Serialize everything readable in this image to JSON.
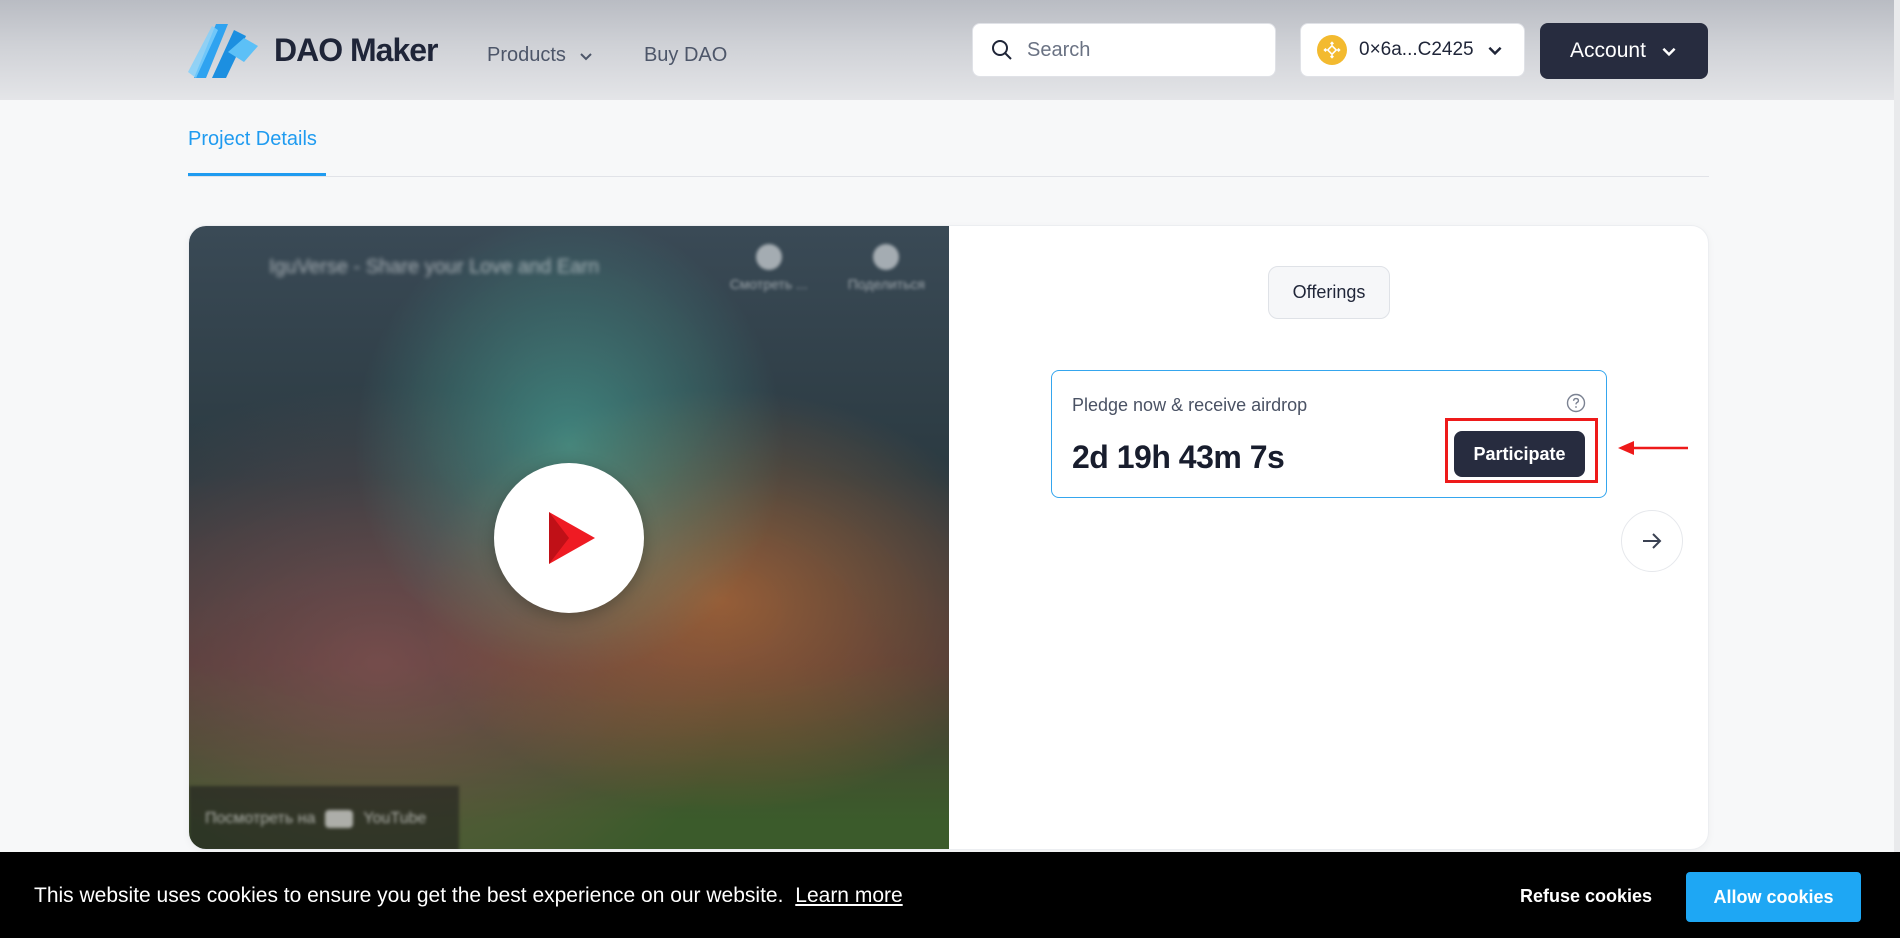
{
  "header": {
    "brand": "DAO Maker",
    "nav": [
      {
        "label": "Products",
        "has_dropdown": true
      },
      {
        "label": "Buy DAO",
        "has_dropdown": false
      }
    ],
    "search_placeholder": "Search",
    "wallet": {
      "address": "0×6a...C2425",
      "icon": "bnb-coin-icon"
    },
    "account_label": "Account"
  },
  "tabs": [
    {
      "label": "Project Details",
      "active": true
    }
  ],
  "video": {
    "title": "IguVerse - Share your Love and Earn",
    "actions": [
      "Смотреть ...",
      "Поделиться"
    ],
    "watch_on": "Посмотреть на",
    "platform": "YouTube"
  },
  "offerings_label": "Offerings",
  "pledge": {
    "label": "Pledge now & receive airdrop",
    "countdown": "2d 19h 43m 7s",
    "participate_label": "Participate"
  },
  "cookie": {
    "message": "This website uses cookies to ensure you get the best experience on our website.",
    "learn_more": "Learn more",
    "refuse_label": "Refuse cookies",
    "allow_label": "Allow cookies"
  },
  "colors": {
    "accent": "#1f9bf0",
    "dark_button": "#272c3f",
    "highlight": "#ee1a1a",
    "allow_button": "#1ea7f4"
  }
}
